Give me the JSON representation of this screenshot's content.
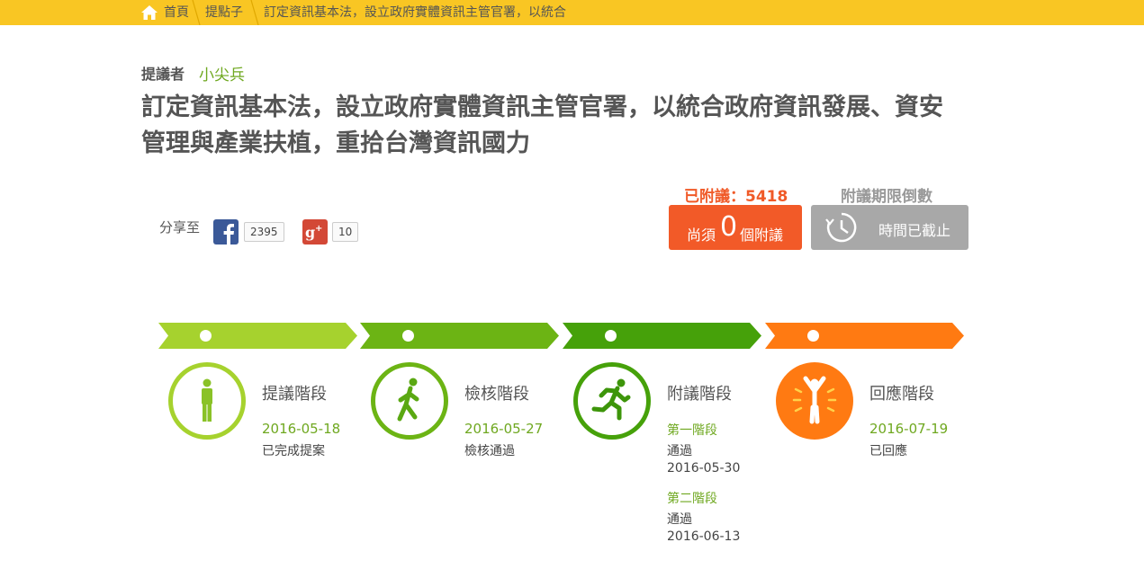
{
  "breadcrumb": {
    "home": "首頁",
    "section": "提點子",
    "current": "訂定資訊基本法，設立政府實體資訊主管官署，以統合"
  },
  "proposer": {
    "label": "提議者",
    "name": "小尖兵"
  },
  "title": "訂定資訊基本法，設立政府實體資訊主管官署，以統合政府資訊發展、資安管理與產業扶植，重拾台灣資訊國力",
  "share": {
    "label": "分享至",
    "facebook_icon": "facebook-icon",
    "facebook_count": "2395",
    "googleplus_icon": "googleplus-icon",
    "googleplus_count": "10"
  },
  "signatures": {
    "signed_text": "已附議：5418",
    "need_prefix": "尚須",
    "need_number": "0",
    "need_suffix": "個附議",
    "countdown_label": "附議期限倒數",
    "countdown_status": "時間已截止"
  },
  "colors": {
    "topbar": "#f9c623",
    "stage1": "#a6d22e",
    "stage2": "#6cb414",
    "stage3": "#46a10a",
    "stage4": "#ff7a12",
    "accent": "#f25a28",
    "green_text": "#6fa820"
  },
  "stages": [
    {
      "name": "提議階段",
      "date": "2016-05-18",
      "status": "已完成提案",
      "icon": "standing-person-icon"
    },
    {
      "name": "檢核階段",
      "date": "2016-05-27",
      "status": "檢核通過",
      "icon": "walking-person-icon"
    },
    {
      "name": "附議階段",
      "icon": "running-person-icon",
      "phases": [
        {
          "title": "第一階段",
          "status": "通過",
          "date": "2016-05-30"
        },
        {
          "title": "第二階段",
          "status": "通過",
          "date": "2016-06-13"
        }
      ]
    },
    {
      "name": "回應階段",
      "date": "2016-07-19",
      "status": "已回應",
      "icon": "cheering-person-icon"
    }
  ]
}
